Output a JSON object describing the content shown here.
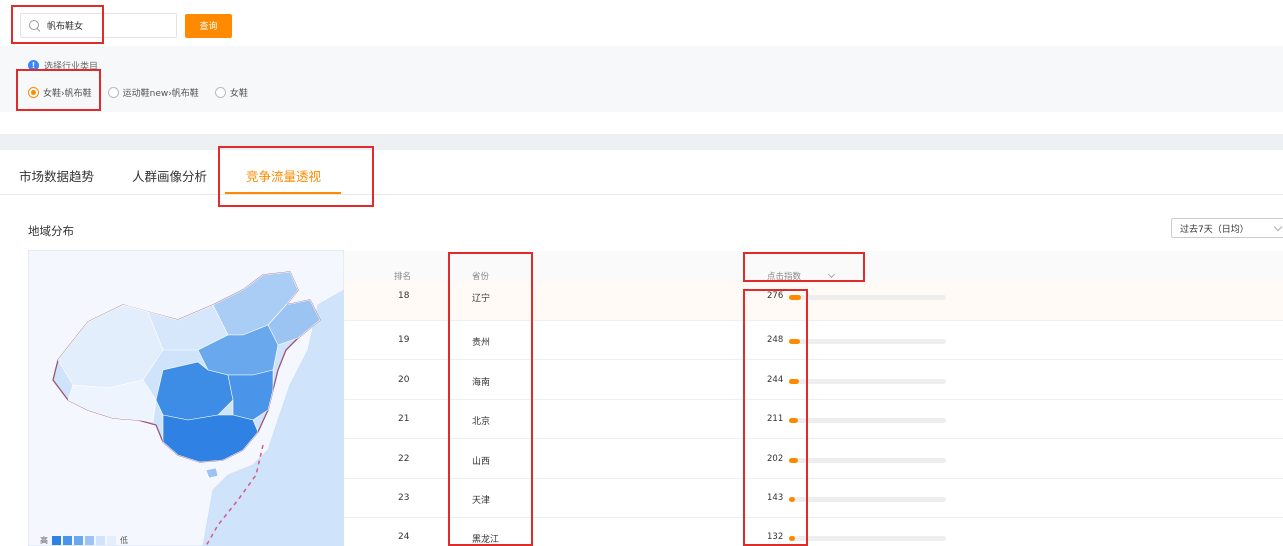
{
  "search": {
    "value": "帆布鞋女",
    "button_label": "查询"
  },
  "category": {
    "hint": "选择行业类目",
    "options": [
      {
        "label": "女鞋›帆布鞋",
        "checked": true
      },
      {
        "label": "运动鞋new›帆布鞋",
        "checked": false
      },
      {
        "label": "女鞋",
        "checked": false
      }
    ]
  },
  "tabs": [
    {
      "label": "市场数据趋势",
      "active": false
    },
    {
      "label": "人群画像分析",
      "active": false
    },
    {
      "label": "竞争流量透视",
      "active": true
    }
  ],
  "section": {
    "title": "地域分布",
    "period": "过去7天（日均）"
  },
  "map": {
    "legend_high": "高",
    "legend_low": "低"
  },
  "table": {
    "headers": {
      "rank": "排名",
      "province": "省份",
      "metric": "点击指数"
    },
    "max_value": 3700,
    "rows": [
      {
        "rank": "18",
        "province": "辽宁",
        "value": 276
      },
      {
        "rank": "19",
        "province": "贵州",
        "value": 248
      },
      {
        "rank": "20",
        "province": "海南",
        "value": 244
      },
      {
        "rank": "21",
        "province": "北京",
        "value": 211
      },
      {
        "rank": "22",
        "province": "山西",
        "value": 202
      },
      {
        "rank": "23",
        "province": "天津",
        "value": 143
      },
      {
        "rank": "24",
        "province": "黑龙江",
        "value": 132
      }
    ]
  },
  "colors": {
    "accent": "#ff8a00",
    "annotation": "#e12a2a",
    "map_dark": "#3d8ce6",
    "map_light": "#dbe9fb"
  }
}
